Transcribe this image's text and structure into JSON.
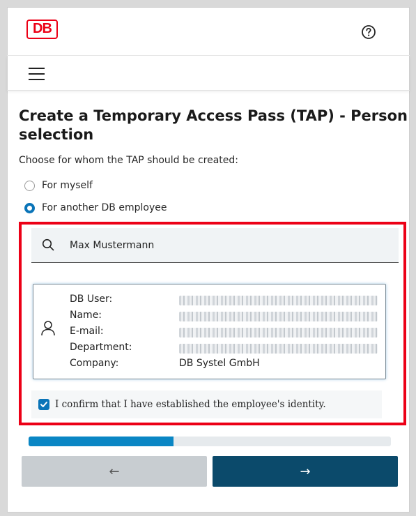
{
  "header": {
    "logo_text": "DB",
    "help_icon": "help-circle-icon",
    "menu_icon": "hamburger-menu-icon"
  },
  "page": {
    "title": "Create a Temporary Access Pass (TAP) - Person selection",
    "prompt": "Choose for whom the TAP should be created:",
    "options": [
      {
        "label": "For myself",
        "selected": false
      },
      {
        "label": "For another DB employee",
        "selected": true
      }
    ]
  },
  "search": {
    "icon": "search-icon",
    "value": "Max Mustermann"
  },
  "user_card": {
    "icon": "user-icon",
    "fields": [
      {
        "label": "DB User:"
      },
      {
        "label": "Name:"
      },
      {
        "label": "E-mail:"
      },
      {
        "label": "Department:"
      },
      {
        "label": "Company:",
        "value": "DB Systel GmbH"
      }
    ]
  },
  "confirm": {
    "checked": true,
    "label": "I confirm that I have established the employee's identity."
  },
  "progress": {
    "fraction": 0.4
  },
  "nav": {
    "back_icon": "arrow-left-icon",
    "back_label": "←",
    "next_icon": "arrow-right-icon",
    "next_label": "→"
  },
  "colors": {
    "brand_red": "#ec0016",
    "accent_blue": "#0a74b8",
    "next_button": "#0b4a6b",
    "back_button": "#c8cdd1"
  }
}
